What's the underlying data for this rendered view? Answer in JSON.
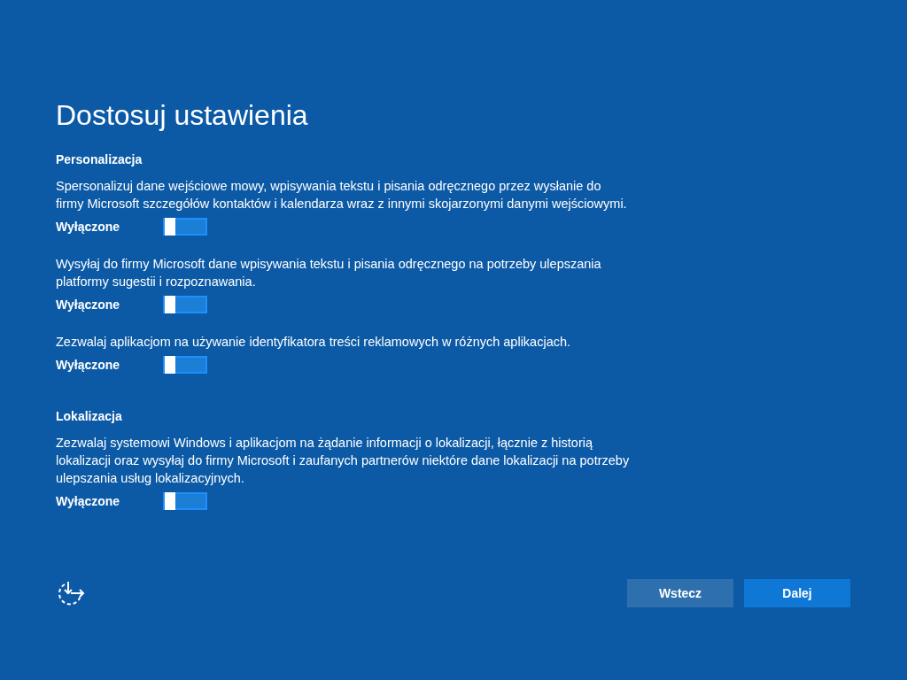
{
  "title": "Dostosuj ustawienia",
  "sections": [
    {
      "heading": "Personalizacja",
      "settings": [
        {
          "description": "Spersonalizuj dane wejściowe mowy, wpisywania tekstu i pisania odręcznego przez wysłanie do firmy Microsoft szczegółów kontaktów i kalendarza wraz z innymi skojarzonymi danymi wejściowymi.",
          "state_label": "Wyłączone",
          "on": false
        },
        {
          "description": "Wysyłaj do firmy Microsoft dane wpisywania tekstu i pisania odręcznego na potrzeby ulepszania platformy sugestii i rozpoznawania.",
          "state_label": "Wyłączone",
          "on": false
        },
        {
          "description": "Zezwalaj aplikacjom na używanie identyfikatora treści reklamowych w różnych aplikacjach.",
          "state_label": "Wyłączone",
          "on": false
        }
      ]
    },
    {
      "heading": "Lokalizacja",
      "settings": [
        {
          "description": "Zezwalaj systemowi Windows i aplikacjom na żądanie informacji o lokalizacji, łącznie z historią lokalizacji oraz wysyłaj do firmy Microsoft i zaufanych partnerów niektóre dane lokalizacji na potrzeby ulepszania usług lokalizacyjnych.",
          "state_label": "Wyłączone",
          "on": false
        }
      ]
    }
  ],
  "buttons": [
    {
      "label": "Wstecz",
      "kind": "secondary"
    },
    {
      "label": "Dalej",
      "kind": "primary"
    }
  ]
}
